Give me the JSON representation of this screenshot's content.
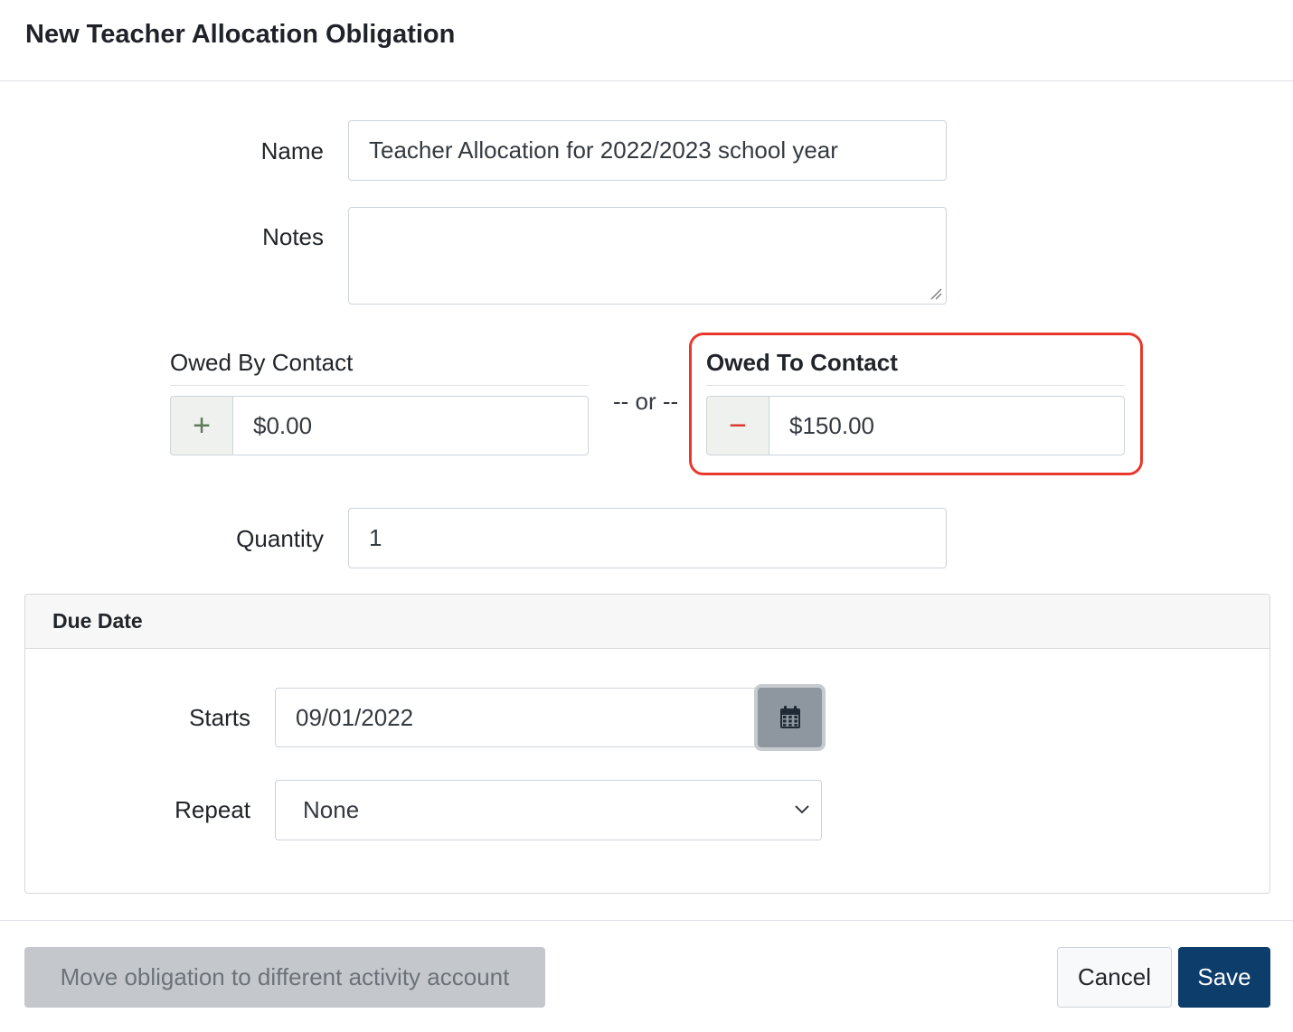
{
  "dialog": {
    "title": "New Teacher Allocation Obligation"
  },
  "form": {
    "name_label": "Name",
    "name_value": "Teacher Allocation for 2022/2023 school year",
    "notes_label": "Notes",
    "notes_value": "",
    "owed_by": {
      "label": "Owed By Contact",
      "sign": "+",
      "value": "$0.00"
    },
    "or_text": "-- or --",
    "owed_to": {
      "label": "Owed To Contact",
      "sign": "−",
      "value": "$150.00",
      "highlighted": true
    },
    "quantity_label": "Quantity",
    "quantity_value": "1"
  },
  "due_date": {
    "title": "Due Date",
    "starts_label": "Starts",
    "starts_value": "09/01/2022",
    "calendar_icon": "calendar-icon",
    "repeat_label": "Repeat",
    "repeat_value": "None"
  },
  "footer": {
    "move_label": "Move obligation to different activity account",
    "cancel_label": "Cancel",
    "save_label": "Save"
  },
  "colors": {
    "save_bg": "#0d3d6b",
    "highlight": "#e8382d",
    "plus": "#5e7a59",
    "minus": "#d93025"
  }
}
